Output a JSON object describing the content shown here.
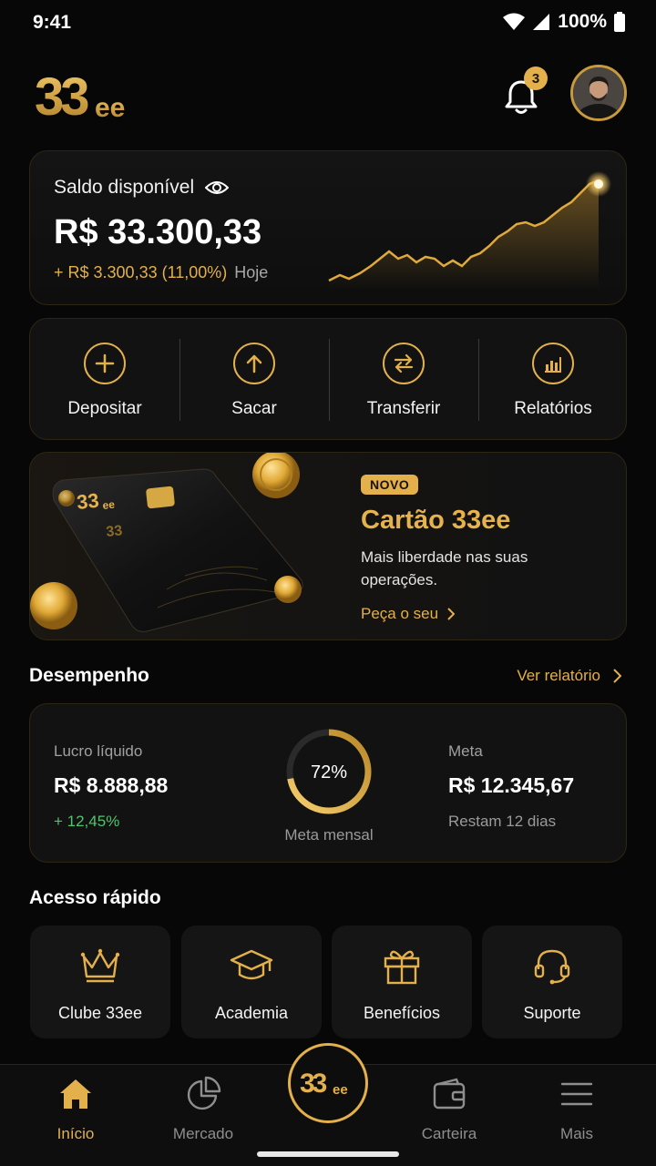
{
  "status_bar": {
    "time": "9:41",
    "battery": "100%"
  },
  "header": {
    "logo_text": "33ee",
    "notification_count": "3"
  },
  "balance": {
    "label": "Saldo disponível",
    "value": "R$ 33.300,33",
    "change": "+ R$ 3.300,33 (11,00%)",
    "period": "Hoje"
  },
  "actions": [
    {
      "label": "Depositar",
      "icon": "plus-circle-icon"
    },
    {
      "label": "Sacar",
      "icon": "arrow-up-circle-icon"
    },
    {
      "label": "Transferir",
      "icon": "transfer-icon"
    },
    {
      "label": "Relatórios",
      "icon": "bar-chart-icon"
    }
  ],
  "promo": {
    "badge": "NOVO",
    "title": "Cartão 33ee",
    "description": "Mais liberdade nas suas operações.",
    "link": "Peça o seu",
    "card_logo": "33ee"
  },
  "performance": {
    "section_title": "Desempenho",
    "see_report": "Ver relatório",
    "profit_label": "Lucro líquido",
    "profit_value": "R$ 8.888,88",
    "profit_change": "+ 12,45%",
    "goal_percent": "72%",
    "goal_percent_value": 0.72,
    "goal_caption": "Meta mensal",
    "target_label": "Meta",
    "target_value": "R$ 12.345,67",
    "remaining": "Restam 12 dias"
  },
  "quick_access": {
    "section_title": "Acesso rápido",
    "items": [
      {
        "label": "Clube 33ee",
        "icon": "crown-icon"
      },
      {
        "label": "Academia",
        "icon": "graduation-cap-icon"
      },
      {
        "label": "Benefícios",
        "icon": "gift-icon"
      },
      {
        "label": "Suporte",
        "icon": "headset-icon"
      }
    ]
  },
  "bottom_nav": {
    "items": [
      {
        "label": "Início",
        "icon": "home-icon",
        "active": true
      },
      {
        "label": "Mercado",
        "icon": "pie-chart-icon"
      },
      {
        "label": "Carteira",
        "icon": "wallet-icon"
      },
      {
        "label": "Mais",
        "icon": "menu-icon"
      }
    ],
    "center_label": "33ee"
  },
  "colors": {
    "accent": "#e3b04b",
    "background": "#070707",
    "card": "#121212",
    "positive": "#4fc46c"
  }
}
